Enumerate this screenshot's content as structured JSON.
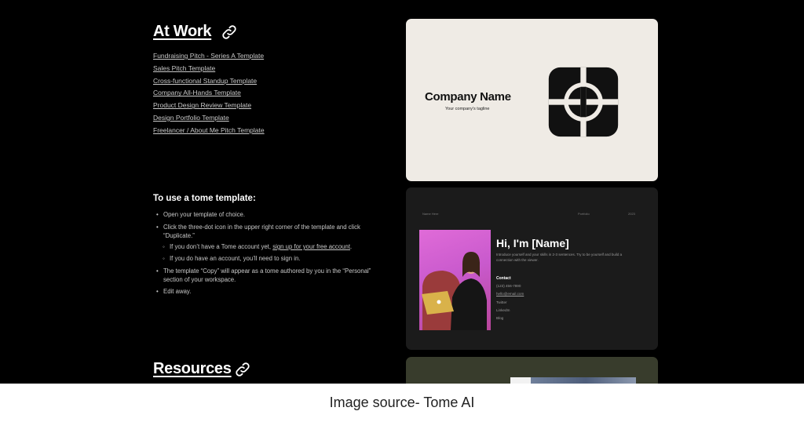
{
  "at_work": {
    "title": "At Work",
    "links": [
      "Fundraising Pitch - Series A Template",
      "Sales Pitch Template",
      "Cross-functional Standup Template",
      "Company All-Hands Template",
      "Product Design Review Template",
      "Design Portfolio Template",
      "Freelancer / About Me Pitch Template"
    ]
  },
  "howto": {
    "title": "To use a tome template:",
    "step1": "Open your template of choice.",
    "step2": "Click the three-dot icon in the upper right corner of the template and click “Duplicate.”",
    "sub1_prefix": "If you don’t have a Tome account yet, ",
    "sub1_link": "sign up for your free account",
    "sub1_suffix": ".",
    "sub2": "If you do have an account, you’ll need to sign in.",
    "step3": "The template “Copy” will appear as a tome authored by you in the “Personal” section of your workspace.",
    "step4": "Edit away."
  },
  "resources": {
    "title": "Resources"
  },
  "cards": {
    "company": {
      "name": "Company Name",
      "tagline": "Your company's tagline"
    },
    "about": {
      "nav": [
        "Name Here",
        "Portfolio",
        "2023"
      ],
      "heading": "Hi, I'm [Name]",
      "intro": "Introduce yourself and your skills in 2-3 sentences. Try to be yourself and build a connection with the viewer.",
      "contact_title": "Contact",
      "contact": [
        "(123) 456-7890",
        "hello@email.com",
        "Twitter",
        "LinkedIn",
        "Blog"
      ]
    }
  },
  "caption": "Image source- Tome AI"
}
